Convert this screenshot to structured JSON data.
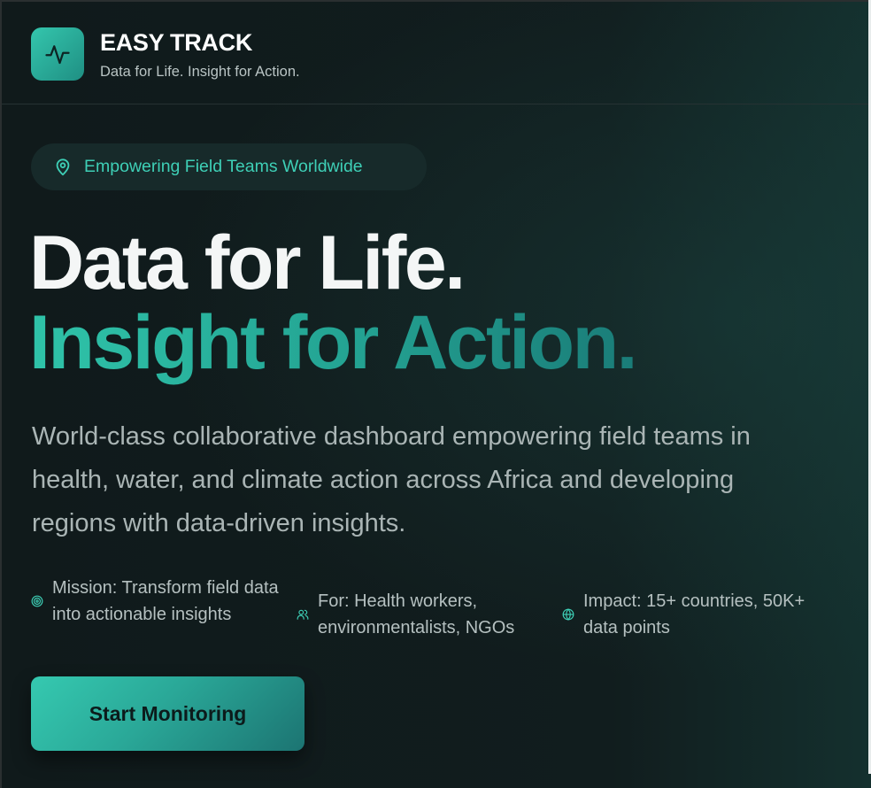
{
  "header": {
    "brand_name": "EASY TRACK",
    "brand_tagline": "Data for Life. Insight for Action.",
    "logo_icon": "activity-pulse-icon"
  },
  "hero": {
    "badge_text": "Empowering Field Teams Worldwide",
    "badge_icon": "map-pin-icon",
    "headline_line1": "Data for Life.",
    "headline_line2": "Insight for Action.",
    "description": "World-class collaborative dashboard empowering field teams in health, water, and climate action across Africa and developing regions with data-driven insights.",
    "features": [
      {
        "icon": "target-icon",
        "text": "Mission: Transform field data into actionable insights"
      },
      {
        "icon": "users-icon",
        "text": "For: Health workers, environmentalists, NGOs"
      },
      {
        "icon": "globe-icon",
        "text": "Impact: 15+ countries, 50K+ data points"
      }
    ],
    "cta_label": "Start Monitoring"
  },
  "colors": {
    "background": "#0f1a1b",
    "accent": "#34c6ad",
    "accent_dark": "#1c7472",
    "headline_white": "#f4f6f6",
    "muted_text": "#aab5b5"
  }
}
